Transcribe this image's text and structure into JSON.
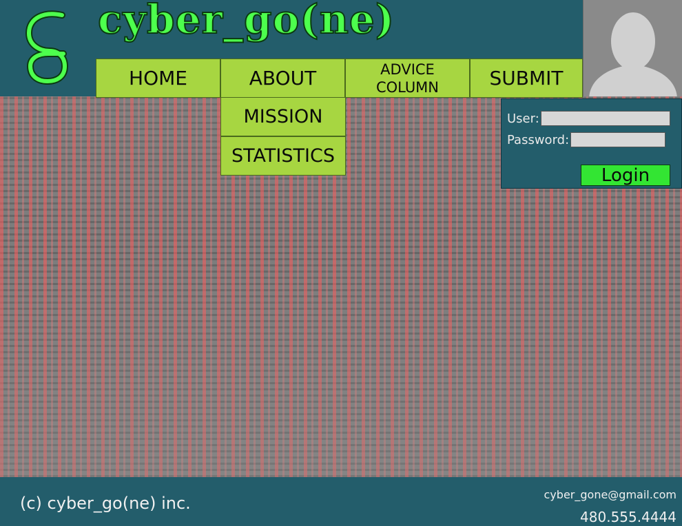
{
  "header": {
    "site_title": "cyber_go(ne)",
    "logo_icon": "cg-monogram-icon"
  },
  "nav": {
    "home": "HOME",
    "about": "ABOUT",
    "advice_line1": "ADVICE",
    "advice_line2": "COLUMN",
    "submit": "SUBMIT"
  },
  "about_submenu": {
    "mission": "MISSION",
    "statistics": "STATISTICS"
  },
  "login": {
    "user_label": "User:",
    "password_label": "Password:",
    "user_value": "",
    "password_value": "",
    "button_label": "Login"
  },
  "avatar": {
    "icon": "user-silhouette-icon"
  },
  "footer": {
    "copyright": "(c) cyber_go(ne) inc.",
    "email": "cyber_gone@gmail.com",
    "phone": "480.555.4444"
  },
  "colors": {
    "header_bg": "#235d6b",
    "nav_bg": "#a7d641",
    "title_green": "#4dff4d",
    "login_button": "#33e533",
    "avatar_bg": "#8a8a8a"
  }
}
